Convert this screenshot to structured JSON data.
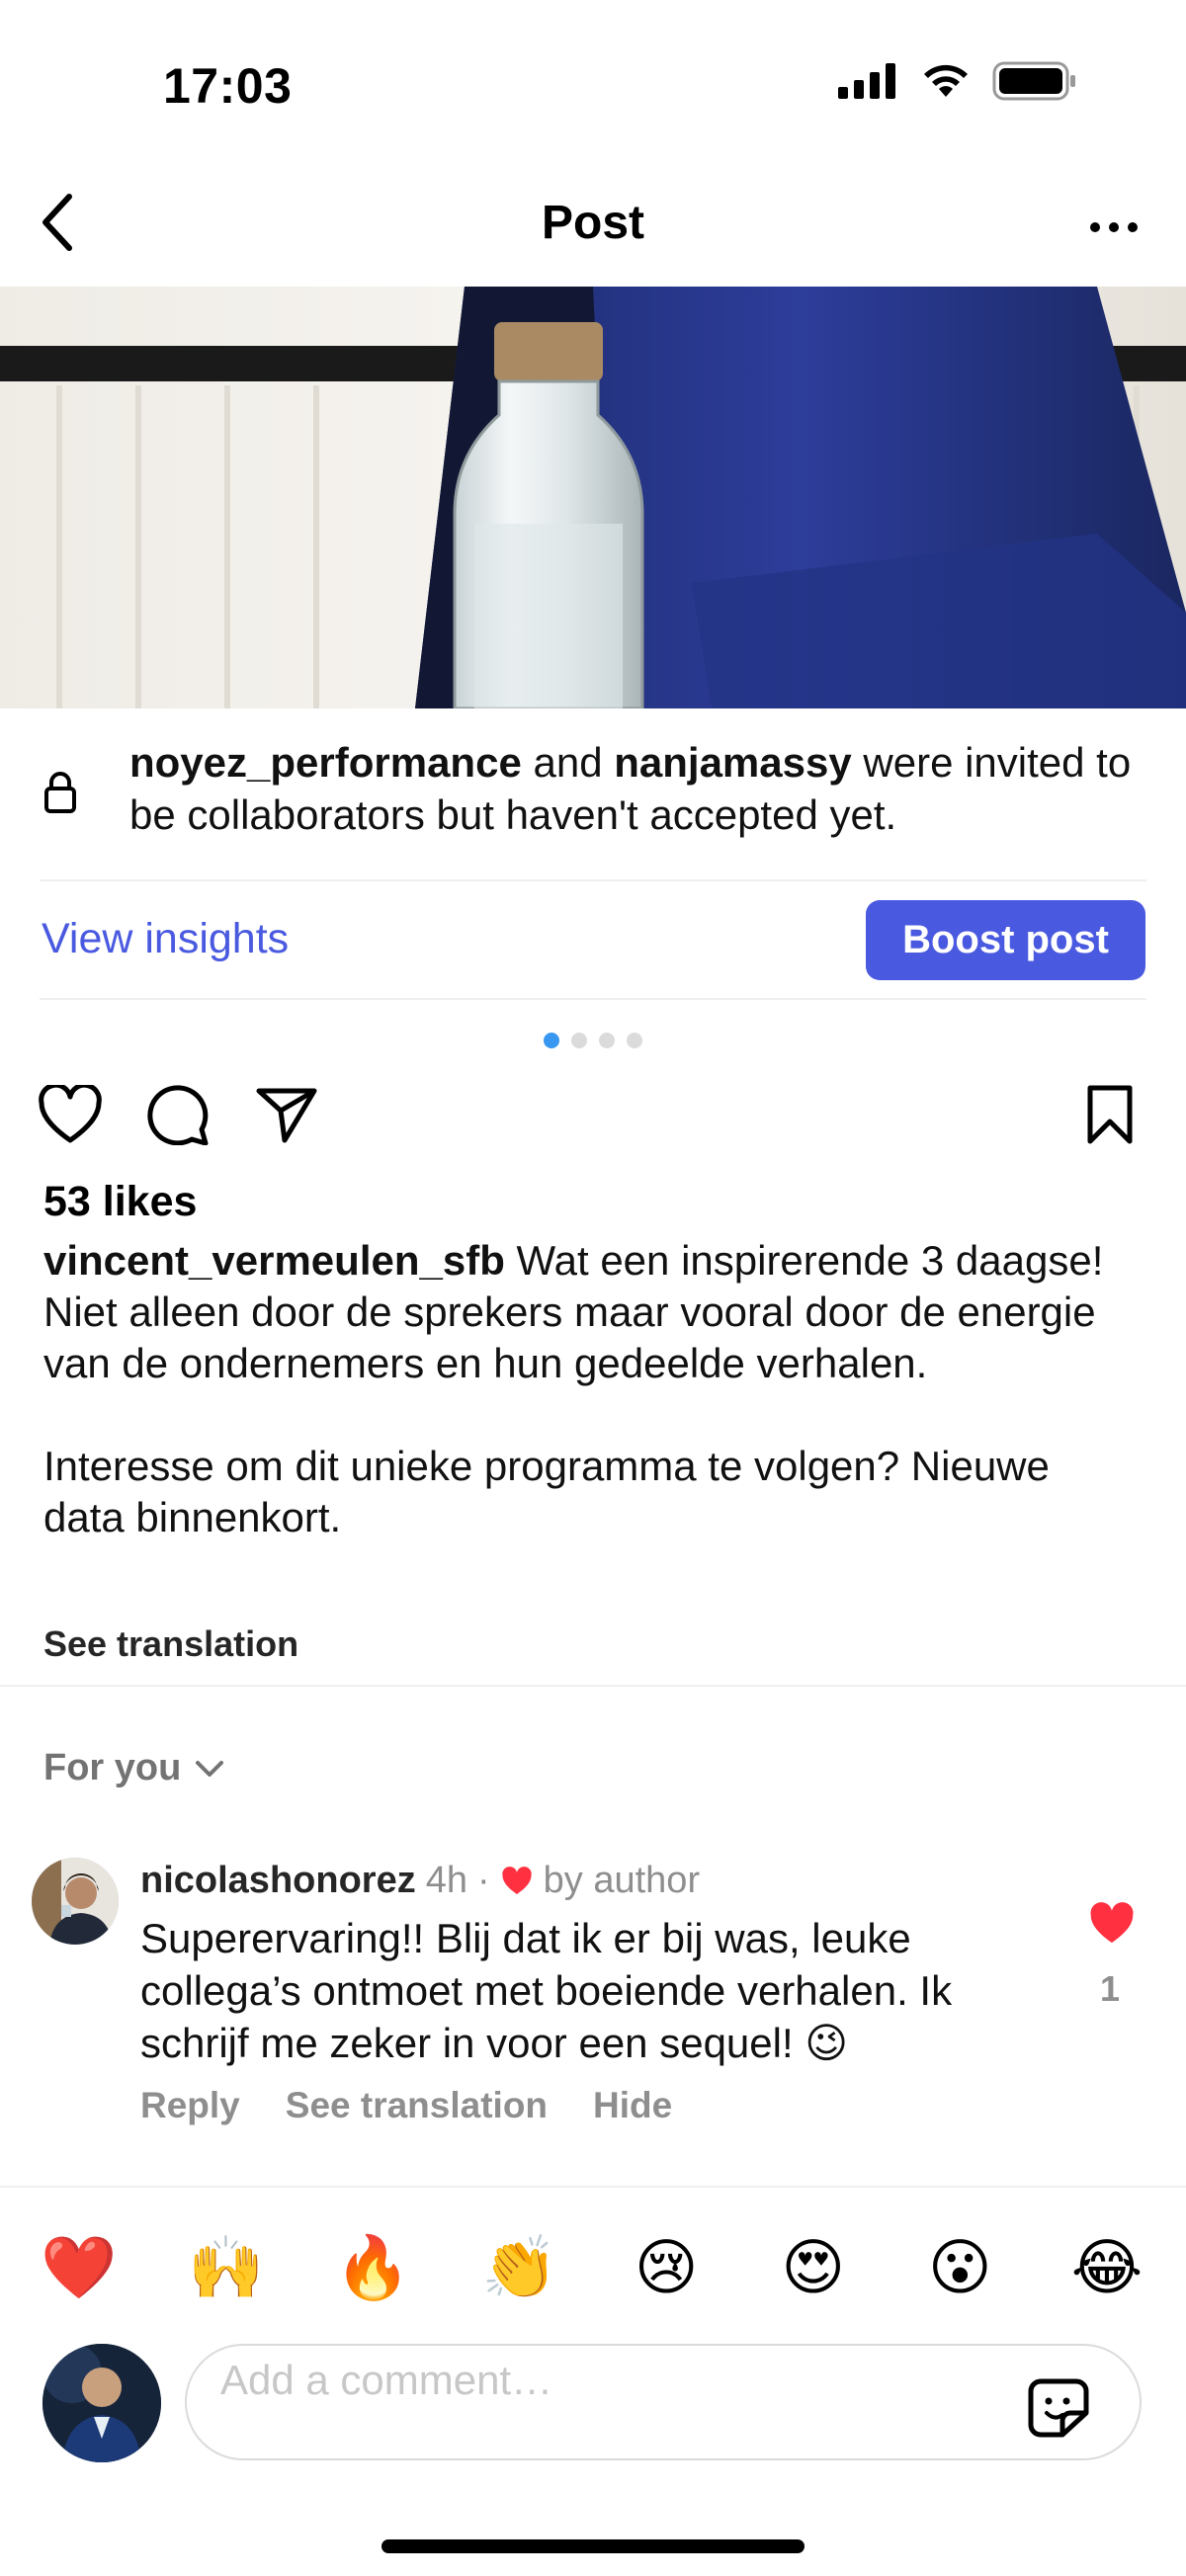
{
  "status_bar": {
    "time": "17:03"
  },
  "nav": {
    "title": "Post"
  },
  "collab": {
    "user1": "noyez_performance",
    "joiner": "and",
    "user2": "nanjamassy",
    "rest": "were invited to be collaborators but haven't accepted yet."
  },
  "insights_label": "View insights",
  "boost_label": "Boost post",
  "carousel": {
    "count": 4,
    "active": 1
  },
  "likes": "53 likes",
  "caption": {
    "user": "vincent_vermeulen_sfb",
    "text1": "Wat een inspirerende 3 daagse! Niet alleen door de sprekers maar vooral door de energie van de ondernemers en hun gedeelde verhalen.",
    "text2": "Interesse om dit unieke programma te volgen? Nieuwe data binnenkort."
  },
  "see_translation": "See translation",
  "filter_label": "For you",
  "comment": {
    "user": "nicolashonorez",
    "time": "4h",
    "separator": "·",
    "by_author": "by author",
    "text": "Superervaring!! Blij dat ik er bij was, leuke collega’s ontmoet met boeiende verhalen. Ik schrijf me zeker in voor een sequel! 😉",
    "reply": "Reply",
    "see_translation": "See translation",
    "hide": "Hide",
    "like_count": "1"
  },
  "emojis": [
    "❤️",
    "🙌",
    "🔥",
    "👏",
    "😢",
    "😍",
    "😮",
    "😂"
  ],
  "comment_input": {
    "placeholder": "Add a comment…"
  },
  "colors": {
    "accent": "#4a5ae0",
    "like_red": "#ff3040",
    "dot_active": "#3897f0"
  },
  "icons": [
    "back-icon",
    "more-icon",
    "lock-icon",
    "heart-icon",
    "comment-icon",
    "share-icon",
    "bookmark-icon",
    "chevron-down-icon",
    "sticker-icon"
  ]
}
